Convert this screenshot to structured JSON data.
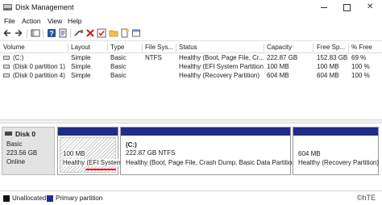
{
  "window": {
    "title": "Disk Management",
    "close_glyph": "✕"
  },
  "menu": [
    "File",
    "Action",
    "View",
    "Help"
  ],
  "toolbar": {
    "icons": [
      "back-arrow-icon",
      "forward-arrow-icon",
      "console-tree-icon",
      "help-icon",
      "properties-icon",
      "connect-icon",
      "delete-icon",
      "check-icon",
      "folder-icon",
      "new-icon",
      "open-icon"
    ]
  },
  "volume_list": {
    "columns": [
      "Volume",
      "Layout",
      "Type",
      "File Sys...",
      "Status",
      "Capacity",
      "Free Sp...",
      "% Free"
    ],
    "rows": [
      [
        "(C:)",
        "Simple",
        "Basic",
        "NTFS",
        "Healthy (Boot, Page File, Cr...",
        "222.87 GB",
        "152.83 GB",
        "69 %"
      ],
      [
        "(Disk 0 partition 1)",
        "Simple",
        "Basic",
        "",
        "Healthy (EFI System Partition)",
        "100 MB",
        "100 MB",
        "100 %"
      ],
      [
        "(Disk 0 partition 4)",
        "Simple",
        "Basic",
        "",
        "Healthy (Recovery Partition)",
        "604 MB",
        "604 MB",
        "100 %"
      ]
    ]
  },
  "disk": {
    "name": "Disk 0",
    "type": "Basic",
    "size": "223.56 GB",
    "status": "Online"
  },
  "partitions": [
    {
      "name": "",
      "size": "100 MB",
      "status": "Healthy (EFI System"
    },
    {
      "name": "(C:)",
      "size": "222.87 GB NTFS",
      "status": "Healthy (Boot, Page File, Crash Dump, Basic Data Partition)"
    },
    {
      "name": "",
      "size": "604 MB",
      "status": "Healthy (Recovery Partition)"
    }
  ],
  "legend": {
    "items": [
      {
        "label": "Unallocated",
        "color": "#111111"
      },
      {
        "label": "Primary partition",
        "color": "#1e2d8a"
      }
    ]
  },
  "watermark": "©hTE",
  "colors": {
    "primary_partition": "#1e2d8a",
    "annotation_underline": "#e4142a"
  }
}
